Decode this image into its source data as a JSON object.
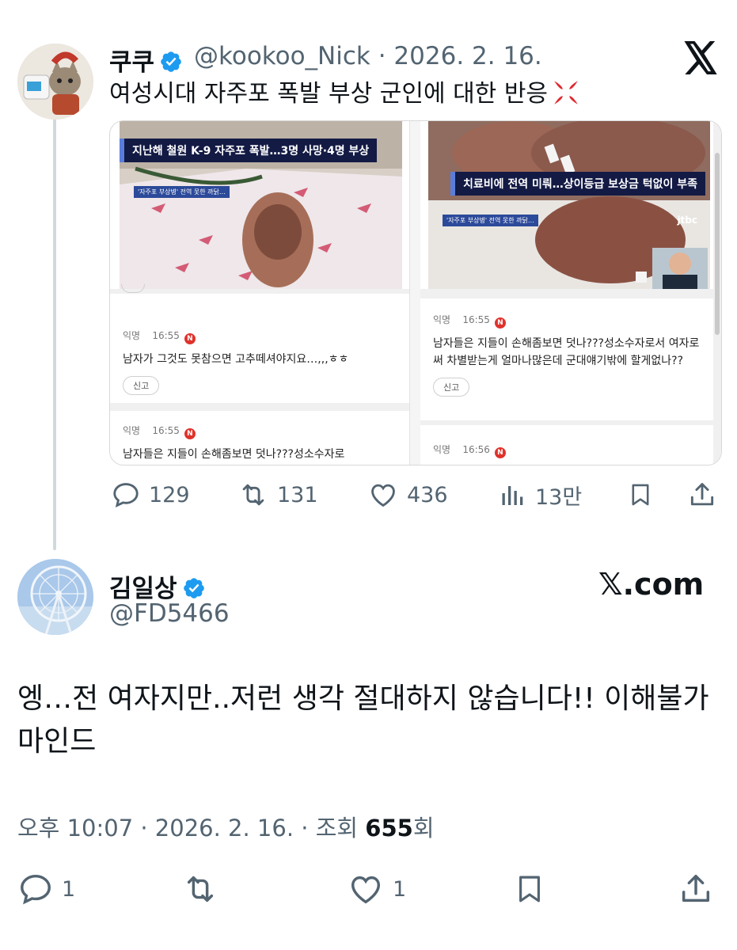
{
  "tweet1": {
    "display_name": "쿠쿠",
    "handle": "@kookoo_Nick",
    "date": "· 2026. 2. 16.",
    "text": "여성시대 자주포 폭발 부상 군인에 대한 반응",
    "media": {
      "left_caption": "지난해 철원 K-9 자주포 폭발…3명 사망·4명 부상",
      "left_tag": "'자주포 부상병' 전역 못한 까닭…",
      "right_caption": "치료비에 전역 미뤄…상이등급 보상금 턱없이 부족",
      "right_tag": "'자주포 부상병' 전역 못한 까닭…",
      "right_watermark": "jtbc",
      "left_comments": [
        {
          "user": "익명",
          "time": "16:55",
          "badge": "N",
          "text": "남자가 그것도 못참으면 고추떼셔야지요…,,,ㅎㅎ",
          "report": "신고"
        },
        {
          "user": "익명",
          "time": "16:55",
          "badge": "N",
          "text": "남자들은 지들이 손해좀보면 덧나???성소수자로"
        }
      ],
      "right_comments": [
        {
          "user": "익명",
          "time": "16:55",
          "badge": "N",
          "text": "남자들은 지들이 손해좀보면 덧나???성소수자로서 여자로써 차별받는게 얼마나많은데 군대얘기밖에 할게없나??",
          "report": "신고"
        },
        {
          "user": "익명",
          "time": "16:56",
          "badge": "N",
          "text": ""
        }
      ]
    },
    "stats": {
      "replies": "129",
      "reposts": "131",
      "likes": "436",
      "views": "13만"
    }
  },
  "tweet2": {
    "display_name": "김일상",
    "handle": "@FD5466",
    "brand": "𝕏.com",
    "text": "엥…전 여자지만..저런 생각 절대하지 않습니다!! 이해불가마인드",
    "time": "오후 10:07 · 2026. 2. 16. · 조회 ",
    "views": "655",
    "views_suffix": "회",
    "stats": {
      "replies": "1",
      "likes": "1"
    }
  },
  "colors": {
    "verified": "#1d9bf0",
    "secondary_text": "#536471",
    "thread_line": "#cfd9de",
    "caption_bg": "#131a44"
  }
}
